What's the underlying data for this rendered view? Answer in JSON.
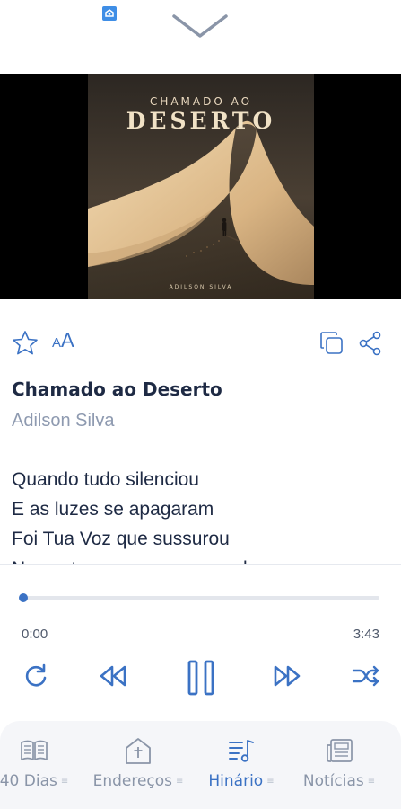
{
  "cover": {
    "title_top": "CHAMADO AO",
    "title_main": "DESERTO",
    "artist": "ADILSON SILVA"
  },
  "actions": {
    "font_small": "A",
    "font_large": "A"
  },
  "song": {
    "title": "Chamado ao Deserto",
    "artist": "Adilson Silva",
    "lyrics": [
      "Quando tudo silenciou",
      "E as luzes se apagaram",
      "Foi Tua Voz que sussurou",
      "No vento que cruzava o nada"
    ]
  },
  "player": {
    "current_time": "0:00",
    "total_time": "3:43",
    "progress": 0.0
  },
  "bottom_nav": {
    "items": [
      {
        "label": "40 Dias",
        "icon": "open-book-icon",
        "active": false
      },
      {
        "label": "Endereços",
        "icon": "church-icon",
        "active": false
      },
      {
        "label": "Hinário",
        "icon": "music-list-icon",
        "active": true
      },
      {
        "label": "Notícias",
        "icon": "newspaper-icon",
        "active": false
      }
    ]
  },
  "colors": {
    "accent": "#3b72c4",
    "text_dark": "#1e2a44",
    "text_muted": "#8e9ab0",
    "nav_inactive": "#8a95a8"
  }
}
